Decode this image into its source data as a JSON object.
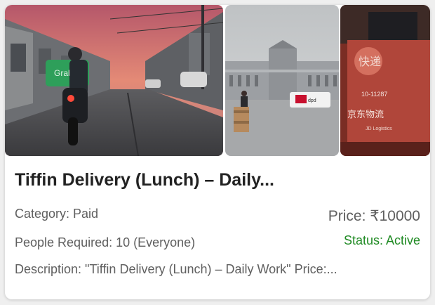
{
  "listing": {
    "title": "Tiffin Delivery (Lunch) – Daily...",
    "category": "Category: Paid",
    "people_required": "People Required: 10 (Everyone)",
    "description": "Description: \"Tiffin Delivery (Lunch) – Daily Work\" Price:...",
    "price": "Price: ₹10000",
    "status": "Status: Active",
    "status_color": "#1f8a23"
  },
  "gallery": {
    "images": [
      {
        "name": "delivery-scooter-photo",
        "sign_text": "Grab"
      },
      {
        "name": "parcel-trolley-photo",
        "sign_text": "dpd"
      },
      {
        "name": "jd-logistics-photo",
        "sign_text": "京东物流",
        "sign_text_2": "JD Logistics",
        "sign_text_3": "10-11287"
      }
    ]
  }
}
